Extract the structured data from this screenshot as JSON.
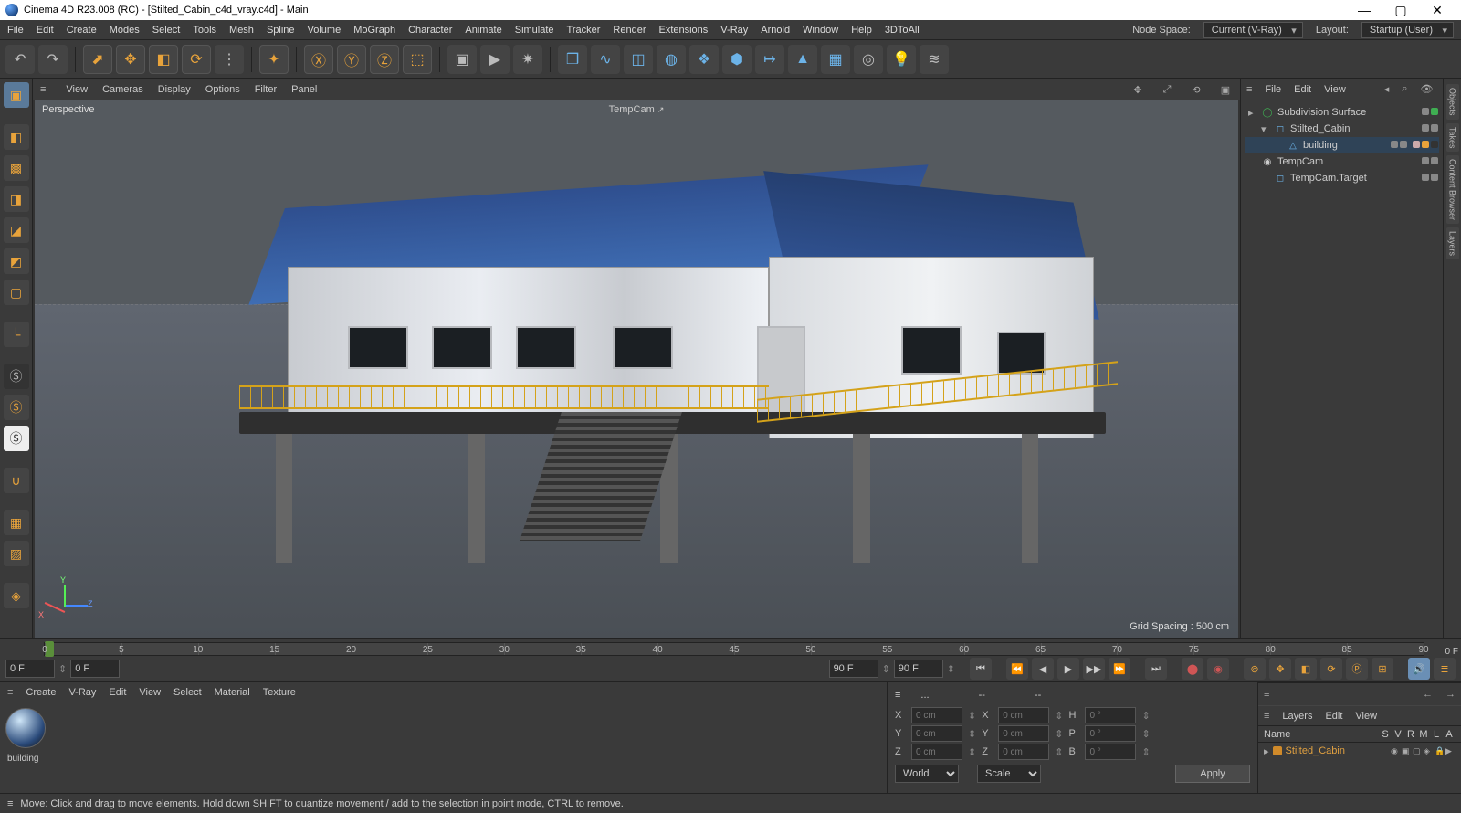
{
  "title": "Cinema 4D R23.008 (RC) - [Stilted_Cabin_c4d_vray.c4d] - Main",
  "menus": [
    "File",
    "Edit",
    "Create",
    "Modes",
    "Select",
    "Tools",
    "Mesh",
    "Spline",
    "Volume",
    "MoGraph",
    "Character",
    "Animate",
    "Simulate",
    "Tracker",
    "Render",
    "Extensions",
    "V-Ray",
    "Arnold",
    "Window",
    "Help",
    "3DToAll"
  ],
  "nodeSpace": {
    "label": "Node Space:",
    "value": "Current (V-Ray)"
  },
  "layout": {
    "label": "Layout:",
    "value": "Startup (User)"
  },
  "viewMenu": [
    "View",
    "Cameras",
    "Display",
    "Options",
    "Filter",
    "Panel"
  ],
  "viewport": {
    "projection": "Perspective",
    "camera": "TempCam",
    "grid": "Grid Spacing : 500 cm"
  },
  "objectsMenu": [
    "File",
    "Edit",
    "View"
  ],
  "tree": [
    {
      "indent": 0,
      "name": "Subdivision Surface",
      "icon": "◯",
      "iconColor": "#3fae52",
      "exp": "▸",
      "checks": [
        "#888",
        "#3fae52"
      ],
      "sel": false
    },
    {
      "indent": 1,
      "name": "Stilted_Cabin",
      "icon": "◻",
      "iconColor": "#6cb3e8",
      "exp": "▾",
      "checks": [
        "#888",
        "#888"
      ],
      "sel": false
    },
    {
      "indent": 2,
      "name": "building",
      "icon": "△",
      "iconColor": "#6cb3e8",
      "exp": "",
      "checks": [
        "#888",
        "#888"
      ],
      "tags": true,
      "sel": true
    },
    {
      "indent": 0,
      "name": "TempCam",
      "icon": "◉",
      "iconColor": "#ccc",
      "exp": "",
      "checks": [
        "#888",
        "#888"
      ],
      "sel": false
    },
    {
      "indent": 1,
      "name": "TempCam.Target",
      "icon": "◻",
      "iconColor": "#6cb3e8",
      "exp": "",
      "checks": [
        "#888",
        "#888"
      ],
      "sel": false
    }
  ],
  "sideTabs": [
    "Objects",
    "Takes",
    "Content Browser",
    "Layers"
  ],
  "timeline": {
    "ticks": [
      0,
      5,
      10,
      15,
      20,
      25,
      30,
      35,
      40,
      45,
      50,
      55,
      60,
      65,
      70,
      75,
      80,
      85,
      90
    ],
    "fieldA": "0 F",
    "fieldB": "0 F",
    "fieldC": "90 F",
    "fieldD": "90 F",
    "endField": "0 F"
  },
  "materialMenu": [
    "Create",
    "V-Ray",
    "Edit",
    "View",
    "Select",
    "Material",
    "Texture"
  ],
  "materialName": "building",
  "coords": {
    "head": [
      "≡",
      "...",
      "--",
      "--"
    ],
    "rows": [
      {
        "a": "X",
        "av": "0 cm",
        "b": "X",
        "bv": "0 cm",
        "c": "H",
        "cv": "0 °"
      },
      {
        "a": "Y",
        "av": "0 cm",
        "b": "Y",
        "bv": "0 cm",
        "c": "P",
        "cv": "0 °"
      },
      {
        "a": "Z",
        "av": "0 cm",
        "b": "Z",
        "bv": "0 cm",
        "c": "B",
        "cv": "0 °"
      }
    ],
    "sysA": "World",
    "sysB": "Scale",
    "apply": "Apply"
  },
  "layersMenu": [
    "Layers",
    "Edit",
    "View"
  ],
  "layersCols": {
    "name": "Name",
    "flags": [
      "S",
      "V",
      "R",
      "M",
      "L",
      "A"
    ]
  },
  "layerRow": {
    "name": "Stilted_Cabin"
  },
  "status": "Move: Click and drag to move elements. Hold down SHIFT to quantize movement / add to the selection in point mode, CTRL to remove."
}
